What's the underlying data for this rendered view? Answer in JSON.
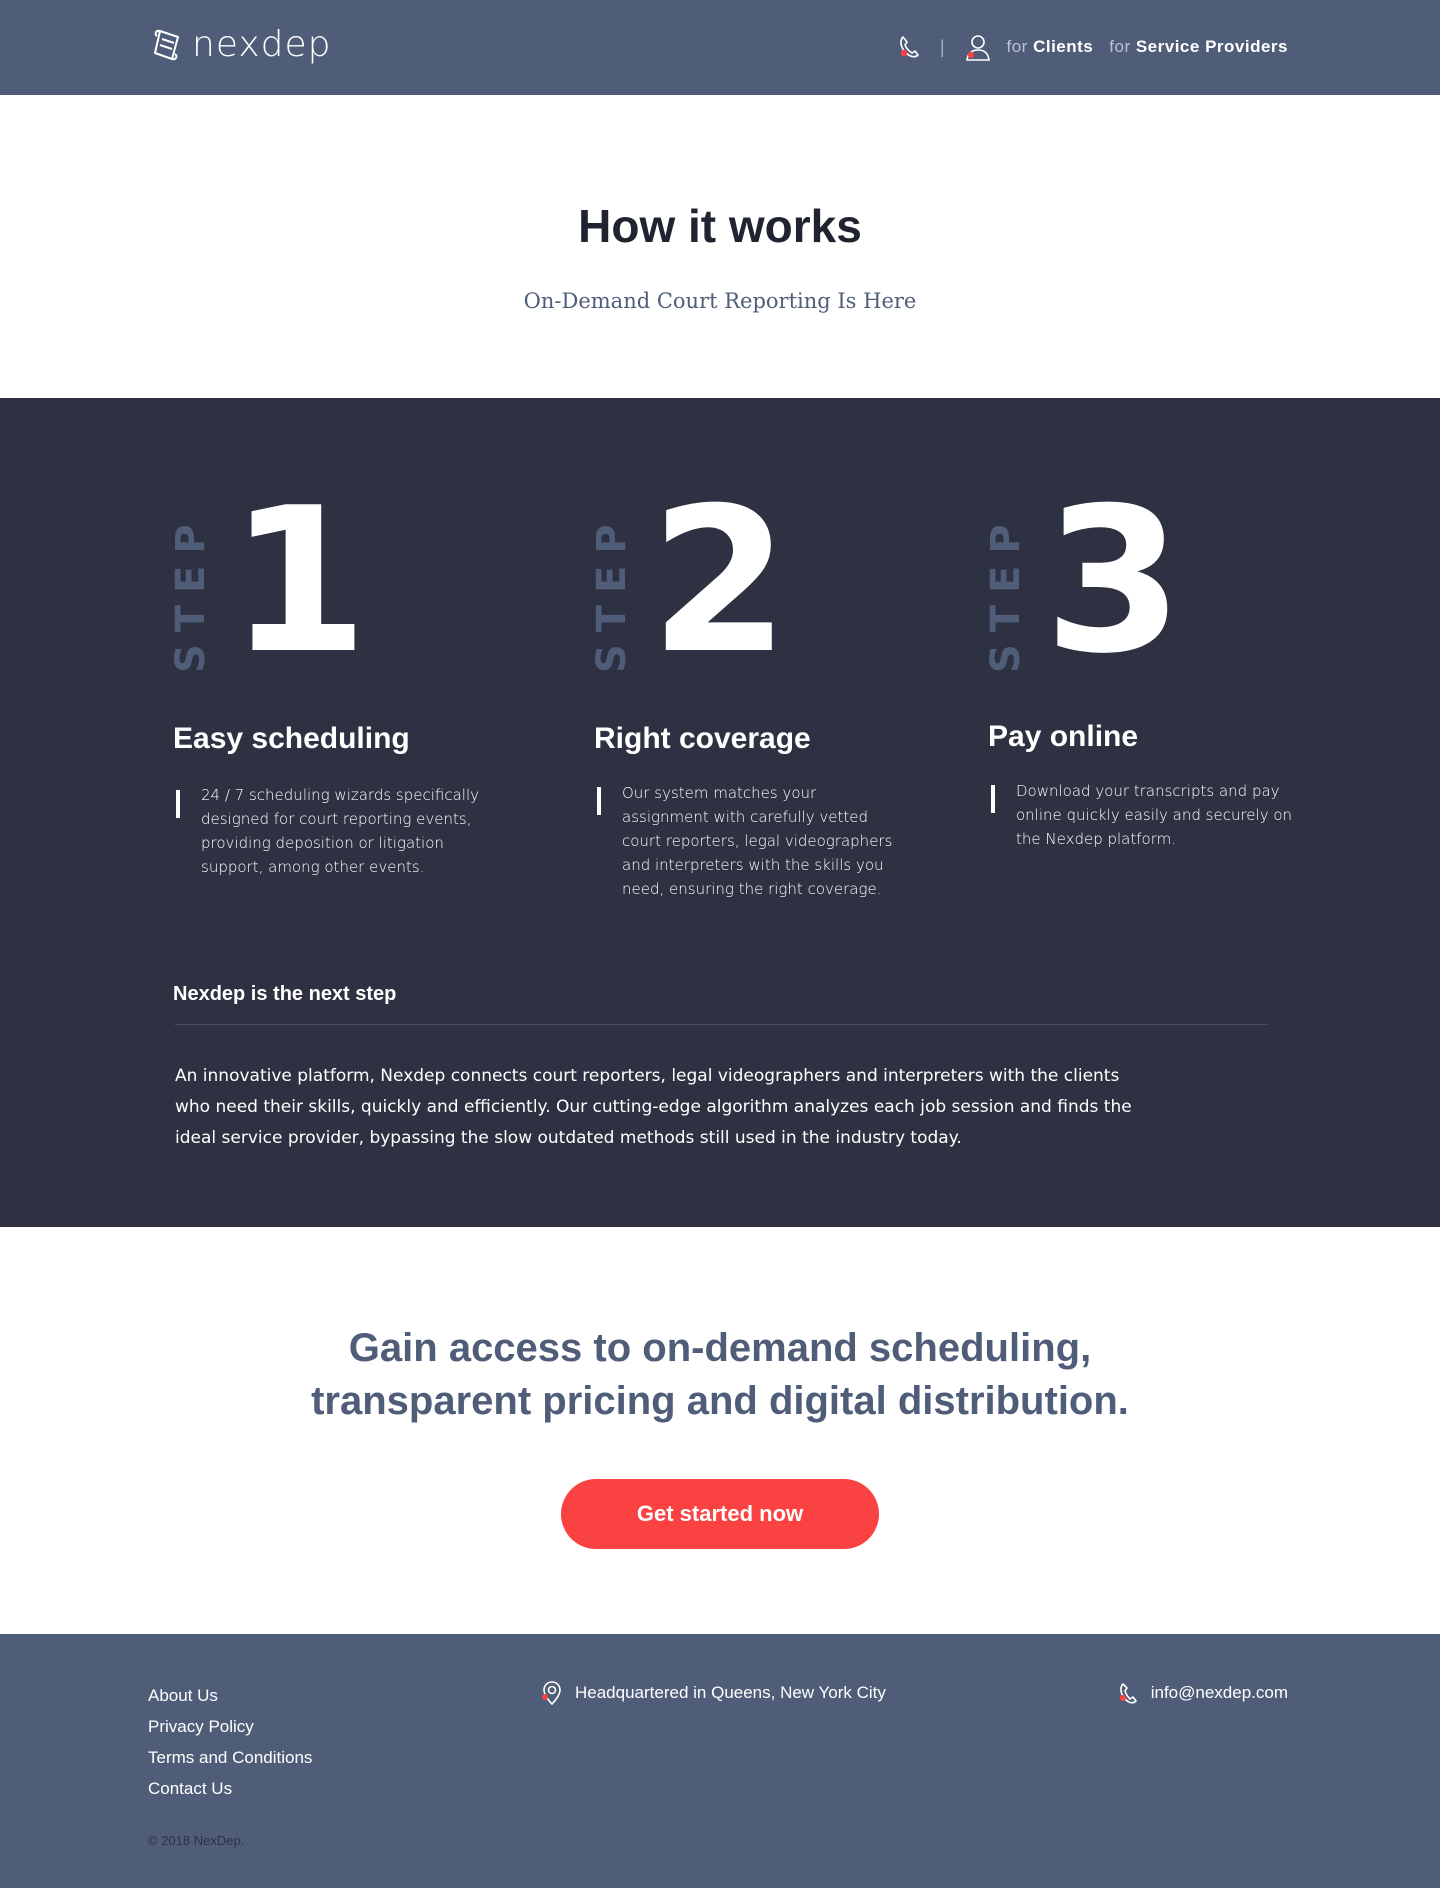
{
  "header": {
    "brand": "nexdep",
    "separator": "|",
    "nav": [
      {
        "prefix": "for",
        "label": "Clients"
      },
      {
        "prefix": "for",
        "label": "Service Providers"
      }
    ]
  },
  "hero": {
    "title": "How it works",
    "subtitle": "On-Demand Court Reporting Is Here"
  },
  "steps": {
    "word": "STEP",
    "items": [
      {
        "number": "1",
        "title": "Easy scheduling",
        "text": "24 / 7 scheduling wizards specifically designed for court reporting events, providing deposition or litigation support, among other events."
      },
      {
        "number": "2",
        "title": "Right coverage",
        "text": "Our system matches your assignment with carefully vetted court reporters, legal videographers and interpreters with the skills you need, ensuring the right coverage."
      },
      {
        "number": "3",
        "title": "Pay online",
        "text": "Download your transcripts and pay online quickly easily and securely on the Nexdep platform."
      }
    ],
    "next_title": "Nexdep is the next step",
    "next_text": "An innovative platform, Nexdep connects court reporters, legal videographers and interpreters with the clients who need their skills, quickly and efficiently. Our cutting-edge algorithm analyzes each job session and finds the ideal service provider, bypassing the slow outdated methods still used in the industry today."
  },
  "cta": {
    "line1": "Gain access to on-demand scheduling,",
    "line2": "transparent pricing and digital distribution.",
    "button": "Get started now"
  },
  "footer": {
    "links": [
      "About Us",
      "Privacy Policy",
      "Terms and Conditions",
      "Contact Us"
    ],
    "address": "Headquartered in Queens, New York City",
    "email": "info@nexdep.com",
    "copyright": "© 2018 NexDep."
  },
  "colors": {
    "header_bg": "#4f5d78",
    "steps_bg": "#2e3142",
    "accent": "#fb4242"
  },
  "icons": {
    "logo": "scroll-logo-icon",
    "phone": "phone-icon",
    "user": "user-icon",
    "location": "location-pin-icon"
  }
}
